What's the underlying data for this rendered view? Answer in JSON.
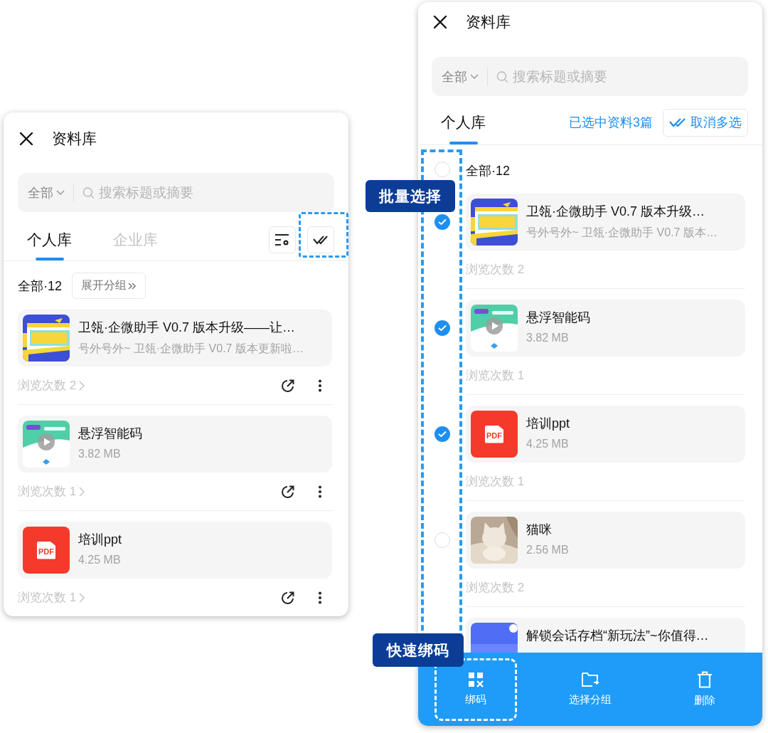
{
  "panels": [
    {
      "kind": "browse",
      "title": "资料库",
      "scope": "全部",
      "search_placeholder": "搜索标题或摘要",
      "tabs": [
        {
          "label": "个人库",
          "selected": true
        },
        {
          "label": "企业库",
          "selected": false
        }
      ],
      "group_label": "全部·12",
      "expand_button": "展开分组",
      "multiselect_highlighted": true,
      "items": [
        {
          "kind": "banner",
          "title": "卫瓴·企微助手 V0.7 版本升级——让…",
          "subtitle": "号外号外~ 卫瓴·企微助手 V0.7 版本更新啦…",
          "views": "浏览次数 2"
        },
        {
          "kind": "video",
          "title": "悬浮智能码",
          "subtitle": "3.82 MB",
          "views": "浏览次数 1"
        },
        {
          "kind": "pdf",
          "badge": "PDF",
          "title": "培训ppt",
          "subtitle": "4.25 MB",
          "views": "浏览次数 1"
        }
      ]
    },
    {
      "kind": "multiselect",
      "title": "资料库",
      "scope": "全部",
      "search_placeholder": "搜索标题或摘要",
      "tabs": [
        {
          "label": "个人库",
          "selected": true
        }
      ],
      "selection_note": "已选中资料3篇",
      "cancel_button": "取消多选",
      "group_label": "全部·12",
      "select_all_checked": false,
      "check_column_highlighted": true,
      "items": [
        {
          "kind": "banner",
          "title": "卫瓴·企微助手 V0.7 版本升级…",
          "subtitle": "号外号外~ 卫瓴·企微助手 V0.7 版本…",
          "views": "浏览次数 2",
          "checked": true
        },
        {
          "kind": "video",
          "title": "悬浮智能码",
          "subtitle": "3.82 MB",
          "views": "浏览次数 1",
          "checked": true
        },
        {
          "kind": "pdf",
          "badge": "PDF",
          "title": "培训ppt",
          "subtitle": "4.25 MB",
          "views": "浏览次数 1",
          "checked": true
        },
        {
          "kind": "cat",
          "title": "猫咪",
          "subtitle": "2.56 MB",
          "views": "浏览次数 2",
          "checked": false
        },
        {
          "kind": "notice",
          "title": "解锁会话存档“新玩法”~你值得…"
        }
      ],
      "actions": [
        {
          "label": "绑码",
          "highlighted": true
        },
        {
          "label": "选择分组",
          "highlighted": false
        },
        {
          "label": "删除",
          "highlighted": false
        }
      ]
    }
  ],
  "callouts": [
    {
      "label": "批量选择"
    },
    {
      "label": "快速绑码"
    }
  ]
}
